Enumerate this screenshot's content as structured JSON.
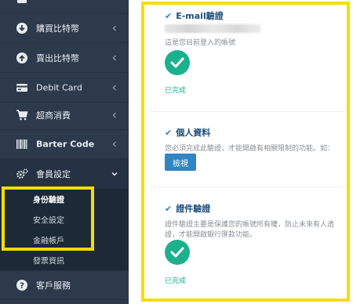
{
  "sidebar": {
    "items": [
      {
        "label": "購買比特幣",
        "icon": "download-circle-icon"
      },
      {
        "label": "賣出比特幣",
        "icon": "upload-circle-icon"
      },
      {
        "label": "Debit Card",
        "icon": "credit-card-icon"
      },
      {
        "label": "超商消費",
        "icon": "shopping-cart-icon"
      },
      {
        "label": "Barter Code",
        "icon": "barcode-icon"
      },
      {
        "label": "會員設定",
        "icon": "gears-icon"
      },
      {
        "label": "客戶服務",
        "icon": "help-circle-icon"
      }
    ],
    "submenu": [
      "身份驗證",
      "安全設定",
      "金融帳戶",
      "發票資訊"
    ]
  },
  "verification": {
    "email": {
      "title": "E-mail驗證",
      "desc": "這是您目前登入的帳號",
      "status": "已完成"
    },
    "personal": {
      "title": "個人資料",
      "desc": "您必須完成此驗證，才能開啟有相關限制的功能。如：",
      "button": "檢視"
    },
    "document": {
      "title": "證件驗證",
      "desc_line1": "證件驗證主要是保護您的帳號所有權，防止未來有人透",
      "desc_line2": "證，才能開啟銀行匯款功能。",
      "status": "已完成"
    }
  },
  "colors": {
    "sidebar_bg": "#2d3a4b",
    "accent_blue": "#2f86c2",
    "success_green": "#1cb08d",
    "highlight_yellow": "#f7dc05"
  }
}
